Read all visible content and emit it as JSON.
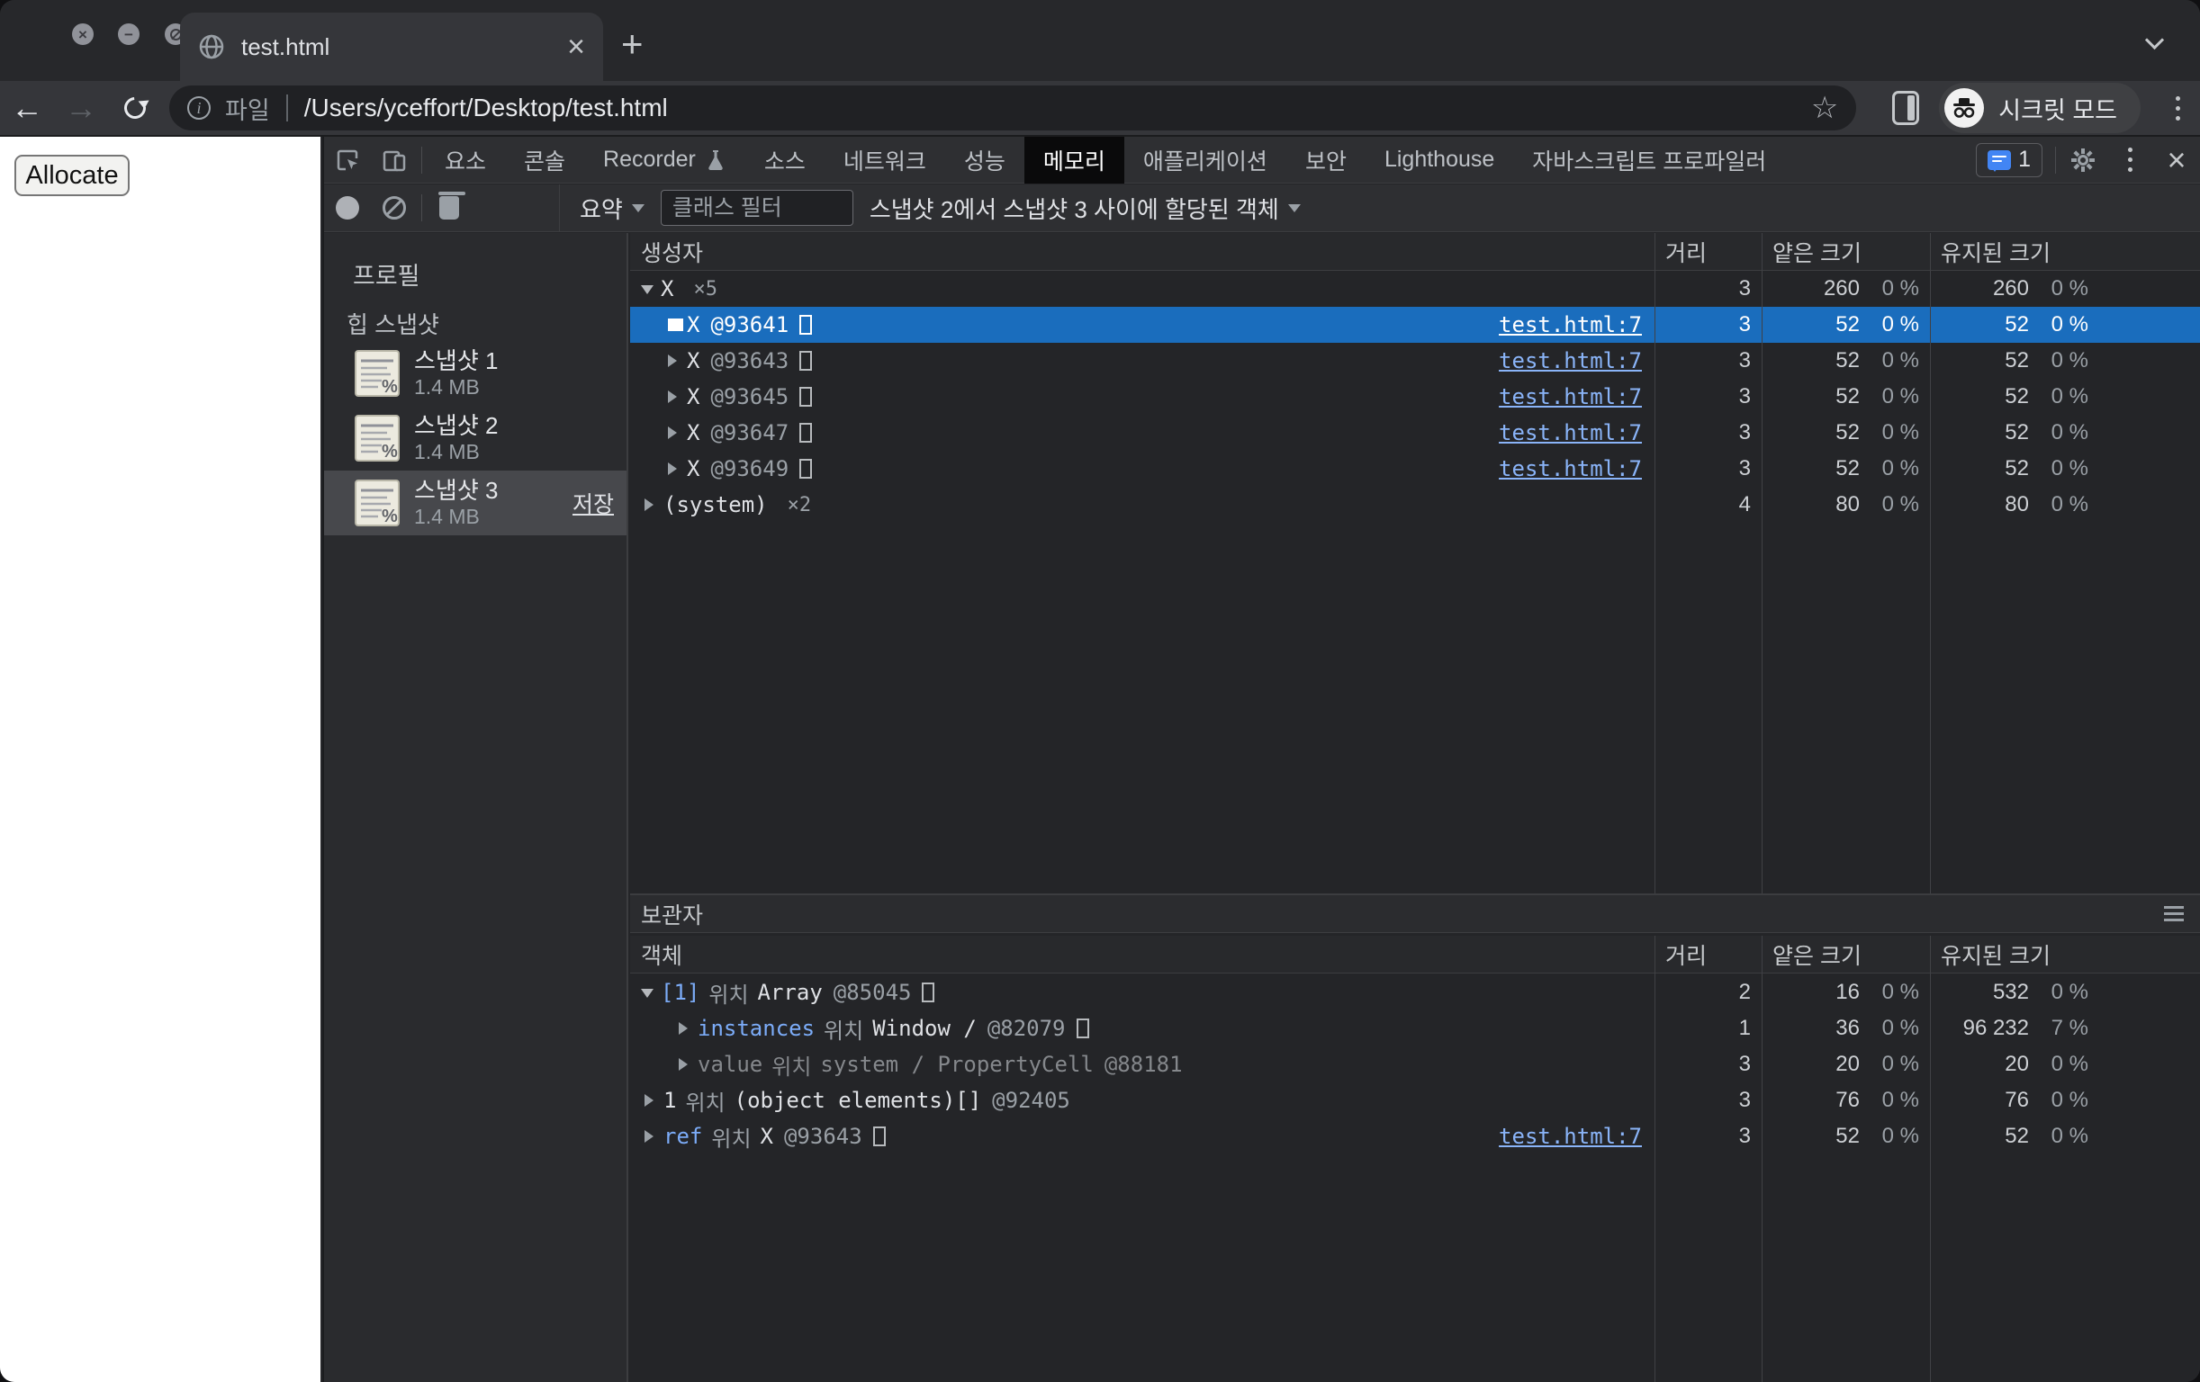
{
  "browser": {
    "tab_title": "test.html",
    "new_tab": "+",
    "close_tab": "×",
    "url_scheme": "파일",
    "url": "/Users/yceffort/Desktop/test.html",
    "incognito_label": "시크릿 모드"
  },
  "page": {
    "allocate_button": "Allocate"
  },
  "colors": {
    "selection_blue": "#1a6dbd",
    "link_blue": "#8ab4f8",
    "issues_blue": "#4285f4"
  },
  "devtools": {
    "tabs": [
      {
        "label": "요소"
      },
      {
        "label": "콘솔"
      },
      {
        "label": "Recorder",
        "flask": true
      },
      {
        "label": "소스"
      },
      {
        "label": "네트워크"
      },
      {
        "label": "성능"
      },
      {
        "label": "메모리",
        "selected": true
      },
      {
        "label": "애플리케이션"
      },
      {
        "label": "보안"
      },
      {
        "label": "Lighthouse"
      },
      {
        "label": "자바스크립트 프로파일러"
      }
    ],
    "issues_count": "1",
    "toolbar": {
      "perspective": "요약",
      "filter_placeholder": "클래스 필터",
      "snapshot_filter": "스냅샷 2에서 스냅샷 3 사이에 할당된 객체"
    },
    "sidebar": {
      "profiles_label": "프로필",
      "heap_label": "힙 스냅샷",
      "snapshots": [
        {
          "name": "스냅샷 1",
          "size": "1.4 MB"
        },
        {
          "name": "스냅샷 2",
          "size": "1.4 MB"
        },
        {
          "name": "스냅샷 3",
          "size": "1.4 MB",
          "selected": true,
          "action": "저장"
        }
      ]
    },
    "constructors": {
      "headers": {
        "ctor": "생성자",
        "distance": "거리",
        "shallow": "얕은 크기",
        "retained": "유지된 크기"
      },
      "rows": [
        {
          "depth": 0,
          "expanded": true,
          "name": "X",
          "count": "×5",
          "distance": "3",
          "shallow": "260",
          "shallow_pct": "0 %",
          "retained": "260",
          "retained_pct": "0 %"
        },
        {
          "depth": 1,
          "name": "X",
          "id": "@93641",
          "box": true,
          "link": "test.html:7",
          "selected": true,
          "distance": "3",
          "shallow": "52",
          "shallow_pct": "0 %",
          "retained": "52",
          "retained_pct": "0 %"
        },
        {
          "depth": 1,
          "name": "X",
          "id": "@93643",
          "box": true,
          "link": "test.html:7",
          "distance": "3",
          "shallow": "52",
          "shallow_pct": "0 %",
          "retained": "52",
          "retained_pct": "0 %"
        },
        {
          "depth": 1,
          "name": "X",
          "id": "@93645",
          "box": true,
          "link": "test.html:7",
          "distance": "3",
          "shallow": "52",
          "shallow_pct": "0 %",
          "retained": "52",
          "retained_pct": "0 %"
        },
        {
          "depth": 1,
          "name": "X",
          "id": "@93647",
          "box": true,
          "link": "test.html:7",
          "distance": "3",
          "shallow": "52",
          "shallow_pct": "0 %",
          "retained": "52",
          "retained_pct": "0 %"
        },
        {
          "depth": 1,
          "name": "X",
          "id": "@93649",
          "box": true,
          "link": "test.html:7",
          "distance": "3",
          "shallow": "52",
          "shallow_pct": "0 %",
          "retained": "52",
          "retained_pct": "0 %"
        },
        {
          "depth": 0,
          "name": "(system)",
          "count": "×2",
          "distance": "4",
          "shallow": "80",
          "shallow_pct": "0 %",
          "retained": "80",
          "retained_pct": "0 %"
        }
      ]
    },
    "retainers": {
      "title": "보관자",
      "object_header": "객체",
      "rows": [
        {
          "depth": 0,
          "expanded": true,
          "prop": "[1]",
          "rel": "위치",
          "obj": "Array",
          "id": "@85045",
          "box": true,
          "distance": "2",
          "shallow": "16",
          "shallow_pct": "0 %",
          "retained": "532",
          "retained_pct": "0 %"
        },
        {
          "depth": 1,
          "prop": "instances",
          "rel": "위치",
          "obj": "Window /",
          "id": "@82079",
          "box": true,
          "distance": "1",
          "shallow": "36",
          "shallow_pct": "0 %",
          "retained": "96 232",
          "retained_pct": "7 %"
        },
        {
          "depth": 1,
          "prop": "value",
          "rel": "위치",
          "obj": "system / PropertyCell",
          "id": "@88181",
          "dimmed": true,
          "distance": "3",
          "shallow": "20",
          "shallow_pct": "0 %",
          "retained": "20",
          "retained_pct": "0 %"
        },
        {
          "depth": 0,
          "prop": "1",
          "prop_plain": true,
          "rel": "위치",
          "obj": "(object elements)[]",
          "id": "@92405",
          "distance": "3",
          "shallow": "76",
          "shallow_pct": "0 %",
          "retained": "76",
          "retained_pct": "0 %"
        },
        {
          "depth": 0,
          "prop": "ref",
          "rel": "위치",
          "obj": "X",
          "id": "@93643",
          "box": true,
          "link": "test.html:7",
          "distance": "3",
          "shallow": "52",
          "shallow_pct": "0 %",
          "retained": "52",
          "retained_pct": "0 %"
        }
      ]
    }
  }
}
